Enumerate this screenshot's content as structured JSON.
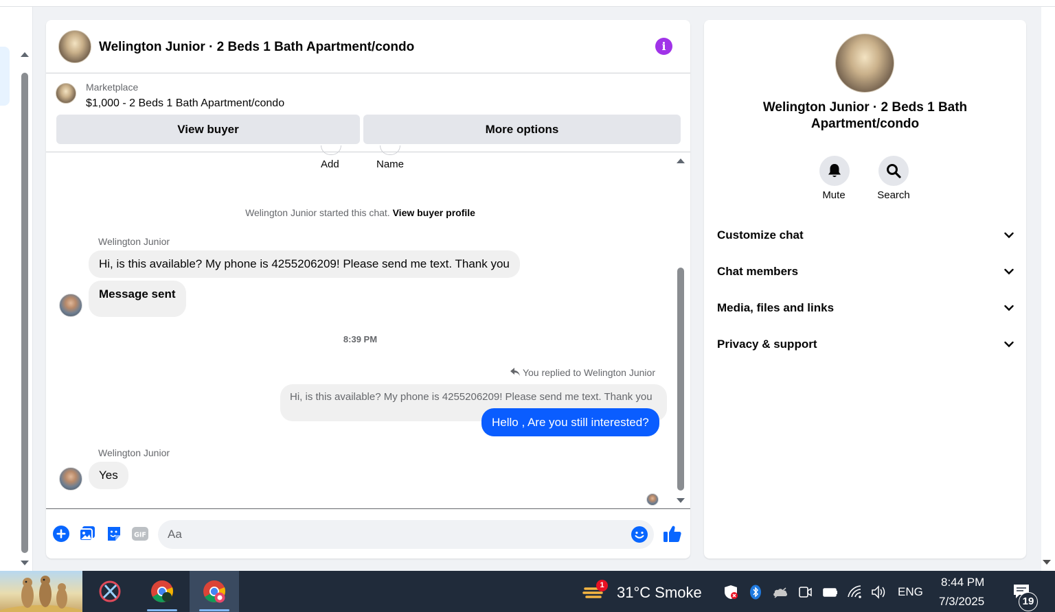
{
  "chat": {
    "title": "Welington Junior · 2 Beds 1 Bath Apartment/condo",
    "marketplace_label": "Marketplace",
    "listing": "$1,000 - 2 Beds 1 Bath Apartment/condo",
    "view_buyer": "View buyer",
    "more_options": "More options",
    "frag_add": "Add",
    "frag_name": "Name",
    "started_text": "Welington Junior started this chat.",
    "started_link": "View buyer profile",
    "sender1": "Welington Junior",
    "msg1": "Hi, is this available? My phone is 4255206209! Please send me text. Thank you",
    "msg2": "Message sent",
    "timestamp": "8:39 PM",
    "replied_to": "You replied to Welington Junior",
    "quoted": "Hi, is this available? My phone is 4255206209! Please send me text. Thank you",
    "my_reply": "Hello , Are you still interested?",
    "sender2": "Welington Junior",
    "msg3": "Yes",
    "input_placeholder": "Aa"
  },
  "sidebar": {
    "title": "Welington Junior · 2 Beds 1 Bath Apartment/condo",
    "mute": "Mute",
    "search": "Search",
    "sections": [
      "Customize chat",
      "Chat members",
      "Media, files and links",
      "Privacy & support"
    ]
  },
  "taskbar": {
    "weather_badge": "1",
    "weather": "31°C  Smoke",
    "lang": "ENG",
    "time": "8:44 PM",
    "date": "7/3/2025",
    "notif_count": "19"
  },
  "colors": {
    "accent": "#0a5dff",
    "info": "#a033e8",
    "icon_blue": "#0866ff"
  }
}
